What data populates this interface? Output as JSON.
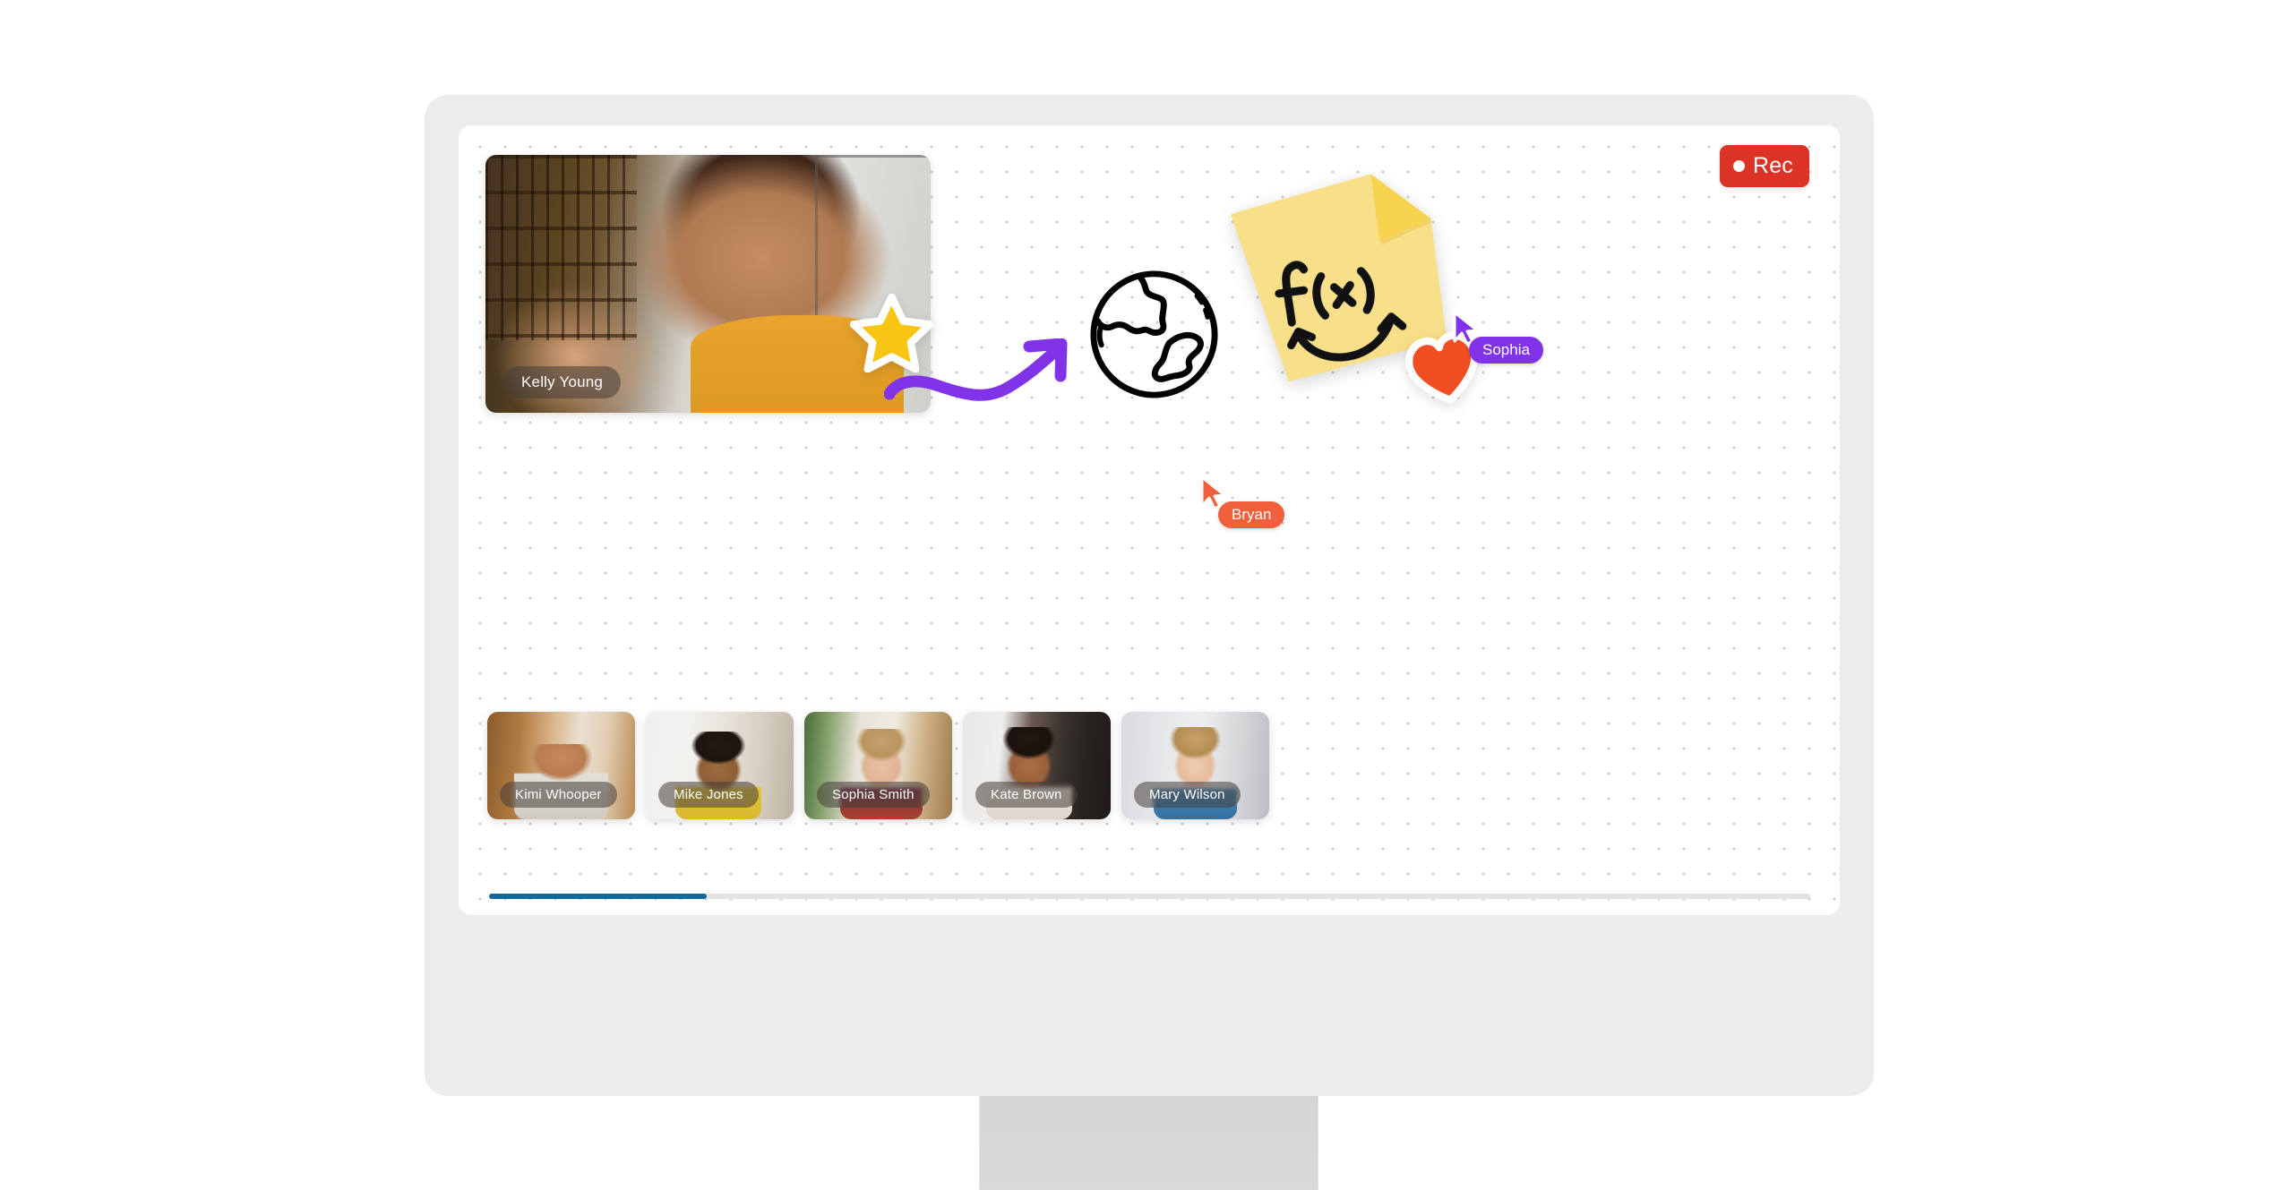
{
  "app": {
    "name": "virtual-classroom-whiteboard",
    "device": "desktop-monitor"
  },
  "recording": {
    "label": "Rec",
    "dot_icon": "record-dot-icon",
    "active": true,
    "color": "#dd3226"
  },
  "main_speaker": {
    "name": "Kelly Young"
  },
  "participants": [
    {
      "name": "Kimi Whooper"
    },
    {
      "name": "Mike Jones"
    },
    {
      "name": "Sophia Smith"
    },
    {
      "name": "Kate Brown"
    },
    {
      "name": "Mary Wilson"
    }
  ],
  "cursors": [
    {
      "name": "Sophia",
      "color": "#8033e8"
    },
    {
      "name": "Bryan",
      "color": "#f0603c"
    }
  ],
  "stickers": {
    "sticky_note": {
      "text": "f(x)",
      "color": "#f8e08a",
      "fold_color": "#f6d44f",
      "annotation": "double-headed-curved-arrow"
    },
    "globe": {
      "icon": "globe-icon",
      "color": "#000000"
    },
    "star": {
      "icon": "star-icon",
      "color": "#f9c513"
    },
    "heart": {
      "icon": "heart-icon",
      "color": "#f04e23"
    },
    "arrow": {
      "icon": "curved-arrow-icon",
      "color": "#8033e8"
    }
  },
  "scrollbar": {
    "track_color": "#e2e2e2",
    "thumb_color": "#10699e",
    "thumb_percent": 16.5
  },
  "canvas": {
    "background": "#ffffff",
    "dot_color": "#c9c9cf"
  }
}
